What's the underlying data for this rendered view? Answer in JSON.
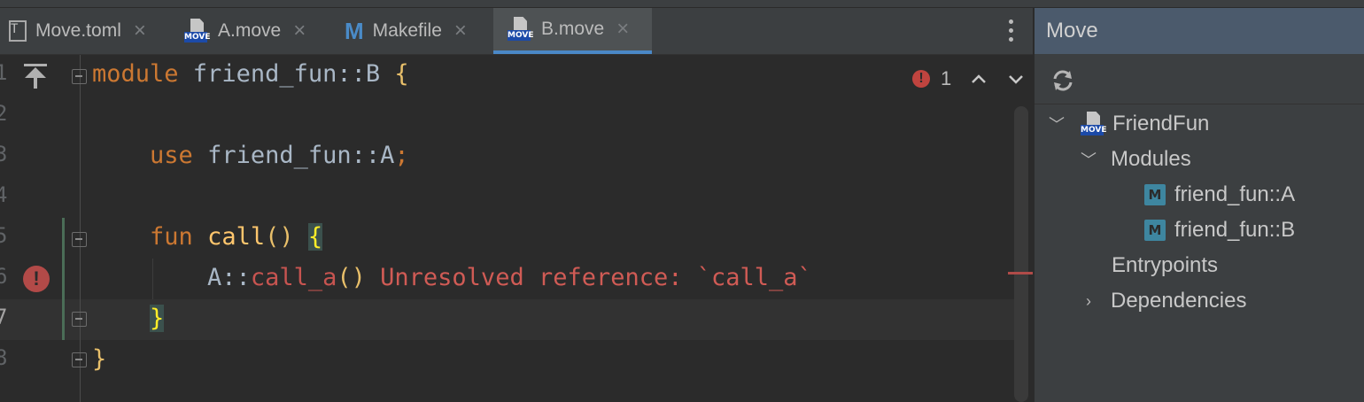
{
  "tabs": [
    {
      "label": "Move.toml",
      "icon": "toml-file-icon",
      "active": false
    },
    {
      "label": "A.move",
      "icon": "move-file-icon",
      "active": false
    },
    {
      "label": "Makefile",
      "icon": "makefile-icon",
      "active": false
    },
    {
      "label": "B.move",
      "icon": "move-file-icon",
      "active": true
    }
  ],
  "editor": {
    "line_numbers": [
      "1",
      "2",
      "3",
      "4",
      "5",
      "6",
      "7",
      "8"
    ],
    "lines": {
      "l1_kw": "module",
      "l1_rest": " friend_fun::B ",
      "l1_brace": "{",
      "l3_indent": "    ",
      "l3_kw": "use",
      "l3_rest": " friend_fun::A",
      "l3_semi": ";",
      "l5_indent": "    ",
      "l5_kw": "fun",
      "l5_fn": "call",
      "l5_parens": "() ",
      "l5_brace": "{",
      "l6_indent": "        ",
      "l6_prefix": "A::",
      "l6_err": "call_a",
      "l6_parens": "()",
      "l6_msg": " Unresolved reference: `call_a`",
      "l7_indent": "    ",
      "l7_brace": "}",
      "l8_brace": "}"
    },
    "inspection": {
      "error_count": "1",
      "error_icon": "error-icon",
      "prev_icon": "chevron-up-icon",
      "next_icon": "chevron-down-icon"
    },
    "colors": {
      "keyword": "#cc7832",
      "function": "#ffc66d",
      "error": "#c75450",
      "text": "#a9b7c6"
    }
  },
  "panel": {
    "title": "Move",
    "refresh_icon": "refresh-icon",
    "tree": {
      "project": "FriendFun",
      "modules_label": "Modules",
      "module_items": [
        {
          "badge": "M",
          "label": "friend_fun::A"
        },
        {
          "badge": "M",
          "label": "friend_fun::B"
        }
      ],
      "entrypoints_label": "Entrypoints",
      "dependencies_label": "Dependencies"
    },
    "badge_text": "MOVE"
  }
}
